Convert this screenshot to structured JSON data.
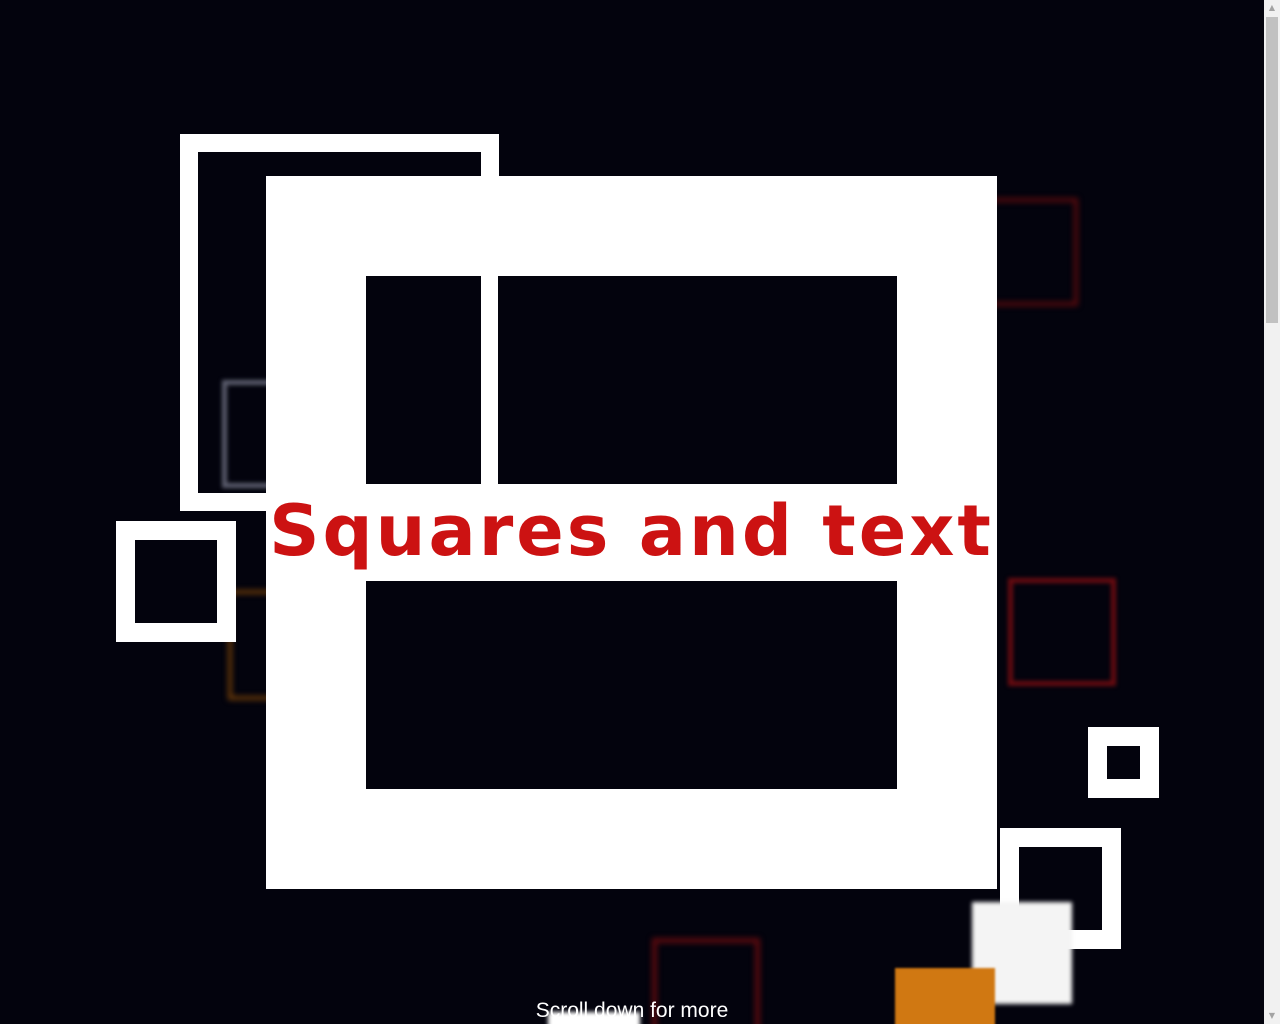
{
  "hero": {
    "title": "Squares and text",
    "scroll_hint": "Scroll down for more"
  },
  "colors": {
    "background": "#03030d",
    "title": "#cc1212",
    "frame": "#ffffff",
    "accent_orange": "#d37a10",
    "accent_red": "#6a0b10"
  },
  "scrollbar": {
    "up_icon": "triangle-up",
    "down_icon": "triangle-down"
  }
}
